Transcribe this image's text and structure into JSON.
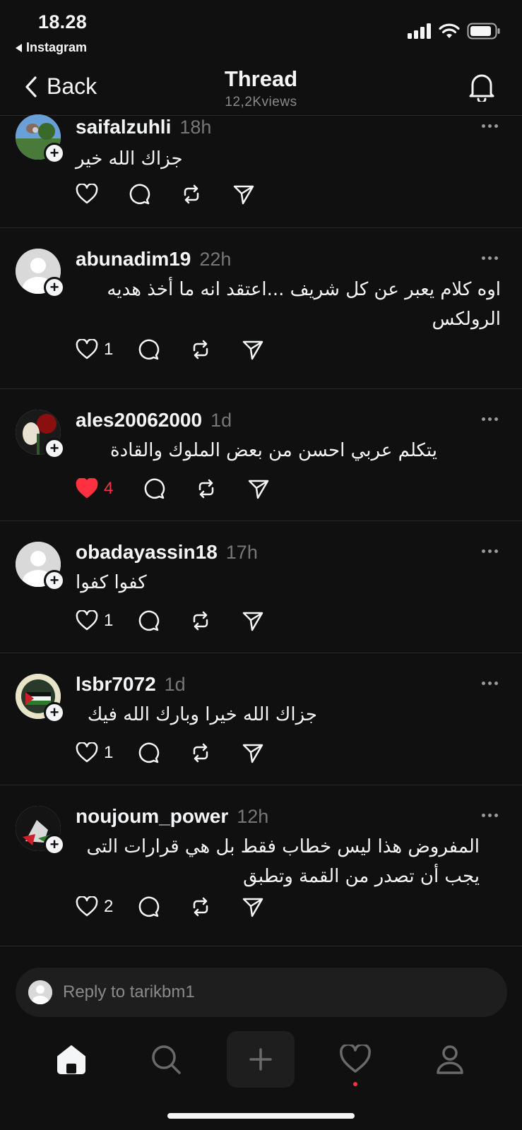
{
  "status": {
    "time": "18.28",
    "back_app": "Instagram"
  },
  "nav": {
    "back_label": "Back",
    "title": "Thread",
    "views": "12,2Kviews"
  },
  "posts": [
    {
      "username": "saifalzuhli",
      "time": "18h",
      "text": "جزاك الله خير",
      "likes": "",
      "liked": false
    },
    {
      "username": "abunadim19",
      "time": "22h",
      "text": "اوه كلام يعبر عن كل شريف ...اعتقد انه ما أخذ هديه الرولكس",
      "likes": "1",
      "liked": false
    },
    {
      "username": "ales20062000",
      "time": "1d",
      "text": "يتكلم عربي احسن من بعض الملوك  والقادة",
      "likes": "4",
      "liked": true
    },
    {
      "username": "obadayassin18",
      "time": "17h",
      "text": "كفوا كفوا",
      "likes": "1",
      "liked": false
    },
    {
      "username": "lsbr7072",
      "time": "1d",
      "text": "جزاك الله خيرا وبارك الله فيك",
      "likes": "1",
      "liked": false
    },
    {
      "username": "noujoum_power",
      "time": "12h",
      "text": "المفروض هذا ليس خطاب فقط بل هي قرارات التى يجب أن تصدر من القمة وتطبق",
      "likes": "2",
      "liked": false
    }
  ],
  "reply": {
    "placeholder": "Reply to tarikbm1"
  },
  "tabs": [
    "home-icon",
    "search-icon",
    "compose-icon",
    "activity-icon",
    "profile-icon"
  ],
  "colors": {
    "background": "#101010",
    "like_red": "#ff3040",
    "muted": "#777777"
  }
}
